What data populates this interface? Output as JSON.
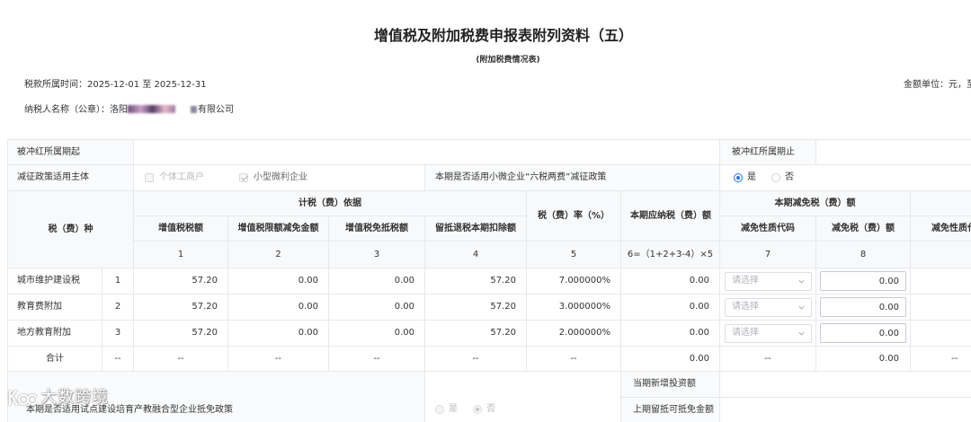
{
  "theme": {
    "accent": "#1677ff"
  },
  "title": "增值税及附加税费申报表附列资料（五）",
  "subtitle": "(附加税费情况表)",
  "period": {
    "label": "税款所属时间：",
    "start": "2025-12-01",
    "sep": "至",
    "end": "2025-12-31"
  },
  "unit": "金额单位：元，至",
  "taxpayer": {
    "label": "纳税人名称（公章）：",
    "name_prefix": "洛阳",
    "name_suffix": "有限公司"
  },
  "form": {
    "reversal_start_label": "被冲红所属期起",
    "reversal_end_label": "被冲红所属期止",
    "reduction_subject_label": "减征政策适用主体",
    "subject_options": [
      {
        "label": "个体工商户",
        "checked": false
      },
      {
        "label": "小型微利企业",
        "checked": true
      }
    ],
    "six_tax_question": "本期是否适用小微企业“六税两费”减征政策",
    "six_tax_options": [
      {
        "label": "是",
        "selected": true
      },
      {
        "label": "否",
        "selected": false
      }
    ]
  },
  "table": {
    "tax_type_header": "税（费）种",
    "basis_header": "计税（费）依据",
    "rate_header": "税（费）率（%）",
    "payable_header": "本期应纳税（费）额",
    "reduction_header": "本期减免税（费）额",
    "columns": {
      "vat": "增值税税额",
      "vat_limit_reduction": "增值税限额减免金额",
      "vat_exempt_offset": "增值税免抵税额",
      "credit_refund_deduction": "留抵退税本期扣除额",
      "reduction_code": "减免性质代码",
      "reduction_amount": "减免税（费）额",
      "next_reduction_code": "减免性质代"
    },
    "column_numbers": [
      "1",
      "2",
      "3",
      "4",
      "5",
      "6=（1+2+3-4）×5",
      "7",
      "8"
    ],
    "select_placeholder": "请选择",
    "rows": [
      {
        "name": "城市维护建设税",
        "index": "1",
        "vat": "57.20",
        "vat_limit_reduction": "0.00",
        "vat_exempt_offset": "0.00",
        "credit_refund_deduction": "57.20",
        "rate": "7.000000%",
        "payable": "0.00",
        "reduction_amount": "0.00"
      },
      {
        "name": "教育费附加",
        "index": "2",
        "vat": "57.20",
        "vat_limit_reduction": "0.00",
        "vat_exempt_offset": "0.00",
        "credit_refund_deduction": "57.20",
        "rate": "3.000000%",
        "payable": "0.00",
        "reduction_amount": "0.00"
      },
      {
        "name": "地方教育附加",
        "index": "3",
        "vat": "57.20",
        "vat_limit_reduction": "0.00",
        "vat_exempt_offset": "0.00",
        "credit_refund_deduction": "57.20",
        "rate": "2.000000%",
        "payable": "0.00",
        "reduction_amount": "0.00"
      }
    ],
    "total": {
      "label": "合计",
      "index": "--",
      "vat": "--",
      "vat_limit_reduction": "--",
      "vat_exempt_offset": "--",
      "credit_refund_deduction": "--",
      "rate": "--",
      "payable": "0.00",
      "reduction_code": "--",
      "reduction_amount": "0.00",
      "next_reduction_code": "--"
    }
  },
  "bottom": {
    "question": "本期是否适用试点建设培育产教融合型企业抵免政策",
    "options": [
      {
        "label": "是",
        "selected": false
      },
      {
        "label": "否",
        "selected": true
      }
    ],
    "new_investment_label": "当期新增投资额",
    "prior_credit_label": "上期留抵可抵免金额"
  },
  "watermark": "大数跨境"
}
